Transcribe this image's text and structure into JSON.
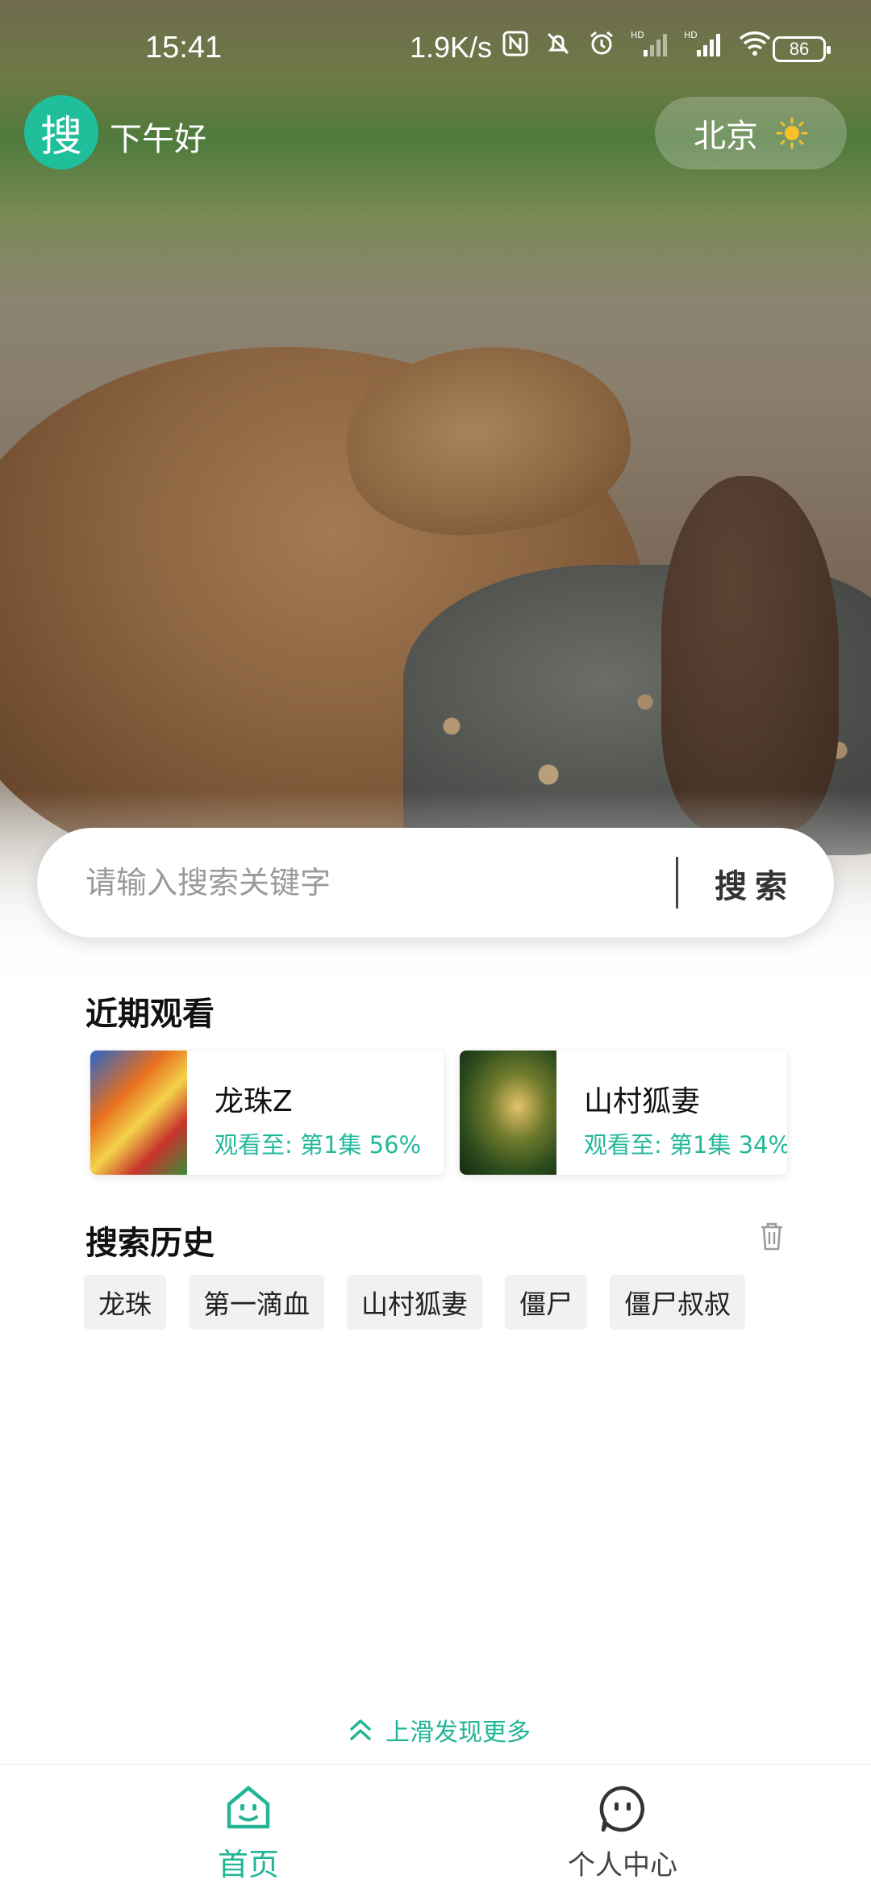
{
  "status_bar": {
    "time": "15:41",
    "network_speed": "1.9K/s",
    "battery": "86"
  },
  "header": {
    "logo_char": "搜",
    "greeting": "下午好",
    "city": "北京",
    "weather_icon": "sun-icon"
  },
  "search": {
    "placeholder": "请输入搜索关键字",
    "button_label": "搜索"
  },
  "recent": {
    "title": "近期观看",
    "items": [
      {
        "name": "龙珠Z",
        "progress": "观看至: 第1集 56%"
      },
      {
        "name": "山村狐妻",
        "progress": "观看至: 第1集 34%"
      }
    ]
  },
  "history": {
    "title": "搜索历史",
    "clear_icon": "trash-icon",
    "items": [
      "龙珠",
      "第一滴血",
      "山村狐妻",
      "僵尸",
      "僵尸叔叔"
    ]
  },
  "slide_more": "上滑发现更多",
  "bottom_nav": {
    "home": "首页",
    "me": "个人中心"
  },
  "colors": {
    "accent": "#22b596",
    "logo_bg": "#1fbf9c"
  }
}
